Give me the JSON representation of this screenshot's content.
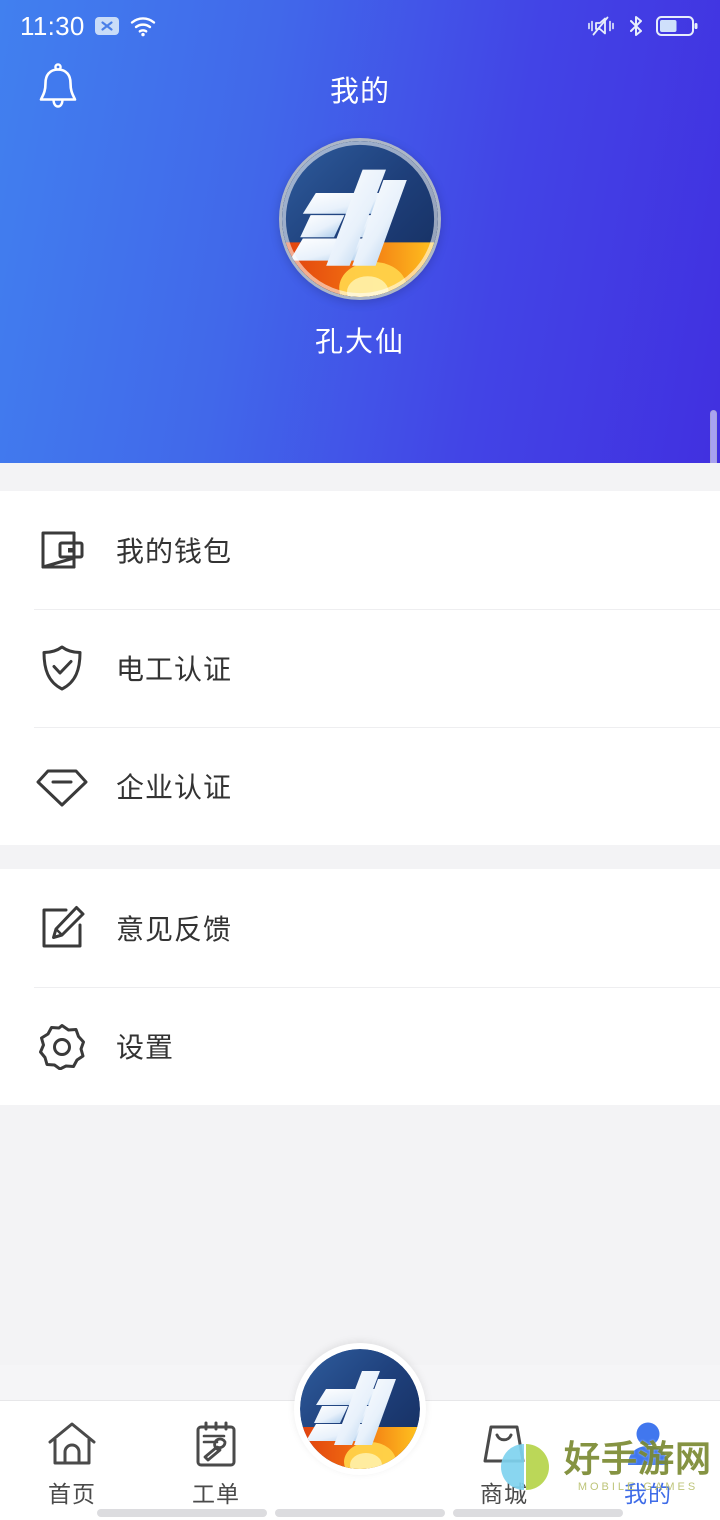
{
  "statusbar": {
    "time": "11:30",
    "icons": [
      "no-sim-x-icon",
      "wifi-icon",
      "vibrate-mute-icon",
      "bluetooth-icon",
      "battery-icon"
    ],
    "battery_level_percent": 50
  },
  "header": {
    "title": "我的",
    "bell_icon": "bell-icon",
    "username": "孔大仙",
    "avatar_icon": "app-logo-dian",
    "gradient_from": "#4180ef",
    "gradient_to": "#4130e0"
  },
  "menu": {
    "group1": [
      {
        "label": "我的钱包",
        "icon": "wallet-icon"
      },
      {
        "label": "电工认证",
        "icon": "shield-check-icon"
      },
      {
        "label": "企业认证",
        "icon": "diamond-icon"
      }
    ],
    "group2": [
      {
        "label": "意见反馈",
        "icon": "edit-square-icon"
      },
      {
        "label": "设置",
        "icon": "gear-icon"
      }
    ]
  },
  "tabbar": {
    "active_color": "#3f6ce8",
    "items": [
      {
        "label": "首页",
        "icon": "home-icon",
        "active": false
      },
      {
        "label": "工单",
        "icon": "clipboard-wrench-icon",
        "active": false
      },
      {
        "label": "",
        "icon": "app-logo-fab",
        "active": false
      },
      {
        "label": "商城",
        "icon": "shopping-bag-icon",
        "active": false
      },
      {
        "label": "我的",
        "icon": "user-icon",
        "active": true
      }
    ]
  },
  "watermark": {
    "title": "好手游网",
    "subtitle": "MOBILE GAMES"
  }
}
